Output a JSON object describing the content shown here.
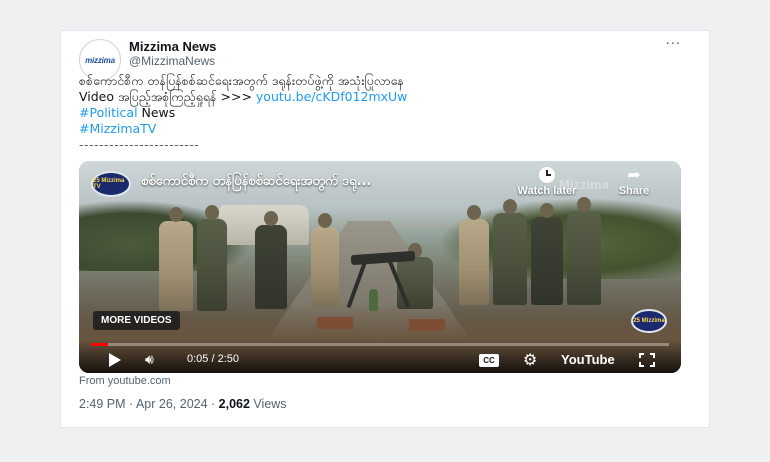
{
  "account": {
    "display_name": "Mizzima News",
    "handle": "@MizzimaNews",
    "avatar_text": "mizzima"
  },
  "more_menu": "···",
  "tweet": {
    "line1": "စစ်ကောင်စီက တန်ပြန်စစ်ဆင်ရေးအတွက် ဒရုန်းတပ်ဖွဲ့ကို အသုံးပြုလာနေ",
    "line2_prefix": "Video အပြည့်အစုံကြည့်ရှုရန် >>> ",
    "line2_link": "youtu.be/cKDf012mxUw",
    "hashtag1": "#Political",
    "hashtag1_rest": " News",
    "hashtag2": "#MizzimaTV",
    "divider": "------------------------"
  },
  "video": {
    "logo_text": "25 Mizzima TV",
    "title": "စစ်ကောင်စီက တန်ပြန်စစ်ဆင်ရေးအတွက် ဒရု...",
    "watermark": "Mizzima",
    "watch_later": "Watch later",
    "share": "Share",
    "more_videos": "MORE VIDEOS",
    "badge_text": "25 Mizzima",
    "time": "0:05 / 2:50",
    "progress": 0.03,
    "cc": "CC",
    "youtube_label": "YouTube",
    "progress_color": "#ff0000"
  },
  "source": "From youtube.com",
  "meta": {
    "time": "2:49 PM · Apr 26, 2024 · ",
    "views_count": "2,062",
    "views_label": " Views"
  },
  "colors": {
    "link": "#1d9bf0",
    "text": "#0f1419",
    "secondary": "#536471"
  }
}
